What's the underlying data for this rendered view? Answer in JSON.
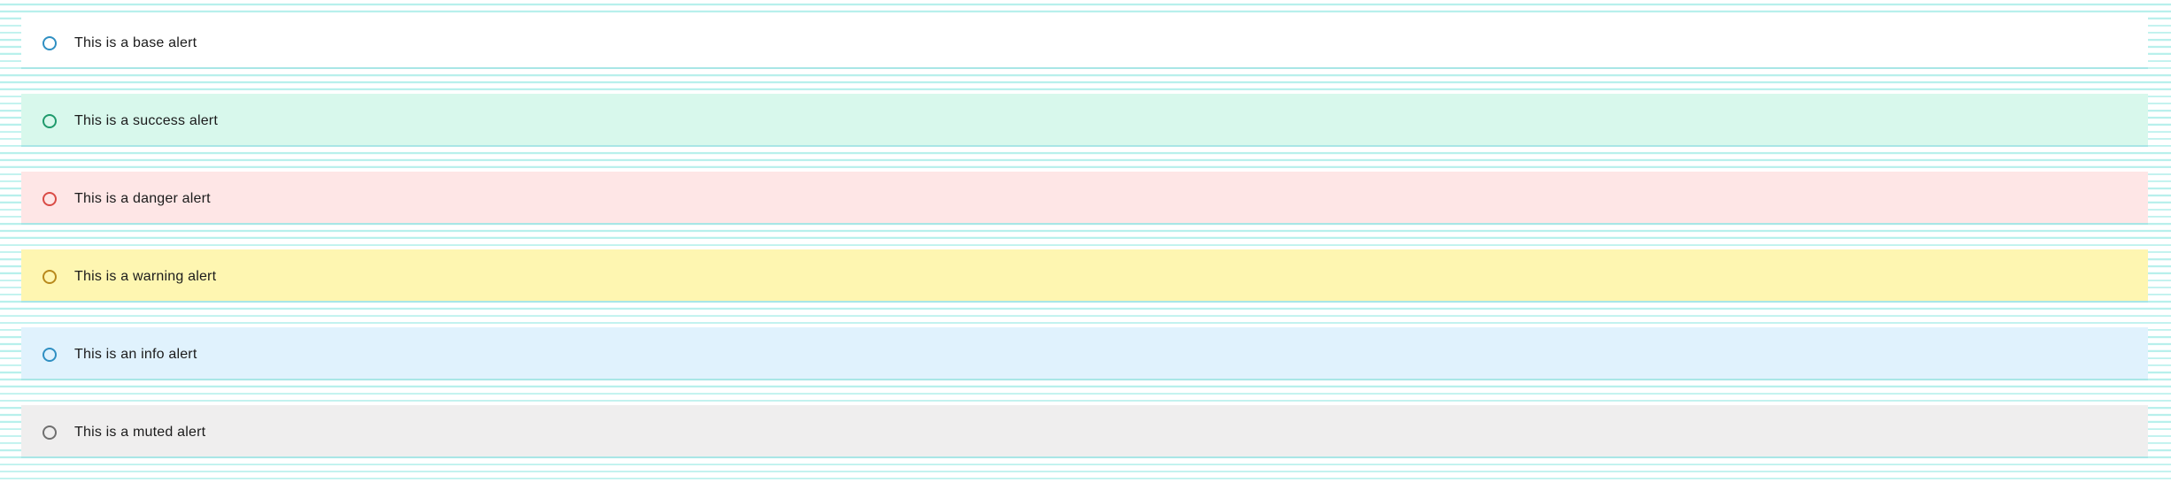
{
  "alerts": [
    {
      "text": "This is a base alert",
      "variant": "base",
      "background": "#ffffff",
      "icon": "circle-outline-icon",
      "icon_color": "#2f8fc2"
    },
    {
      "text": "This is a success alert",
      "variant": "success",
      "background": "#d8f8ec",
      "icon": "circle-outline-icon",
      "icon_color": "#1f9a6c"
    },
    {
      "text": "This is a danger alert",
      "variant": "danger",
      "background": "#fee6e6",
      "icon": "circle-outline-icon",
      "icon_color": "#d94b45"
    },
    {
      "text": "This is a warning alert",
      "variant": "warning",
      "background": "#fef6b1",
      "icon": "circle-outline-icon",
      "icon_color": "#b8891c"
    },
    {
      "text": "This is an info alert",
      "variant": "info",
      "background": "#e0f2fd",
      "icon": "circle-outline-icon",
      "icon_color": "#2f8fc2"
    },
    {
      "text": "This is a muted alert",
      "variant": "muted",
      "background": "#efeeee",
      "icon": "circle-outline-icon",
      "icon_color": "#6f6f6f"
    }
  ]
}
